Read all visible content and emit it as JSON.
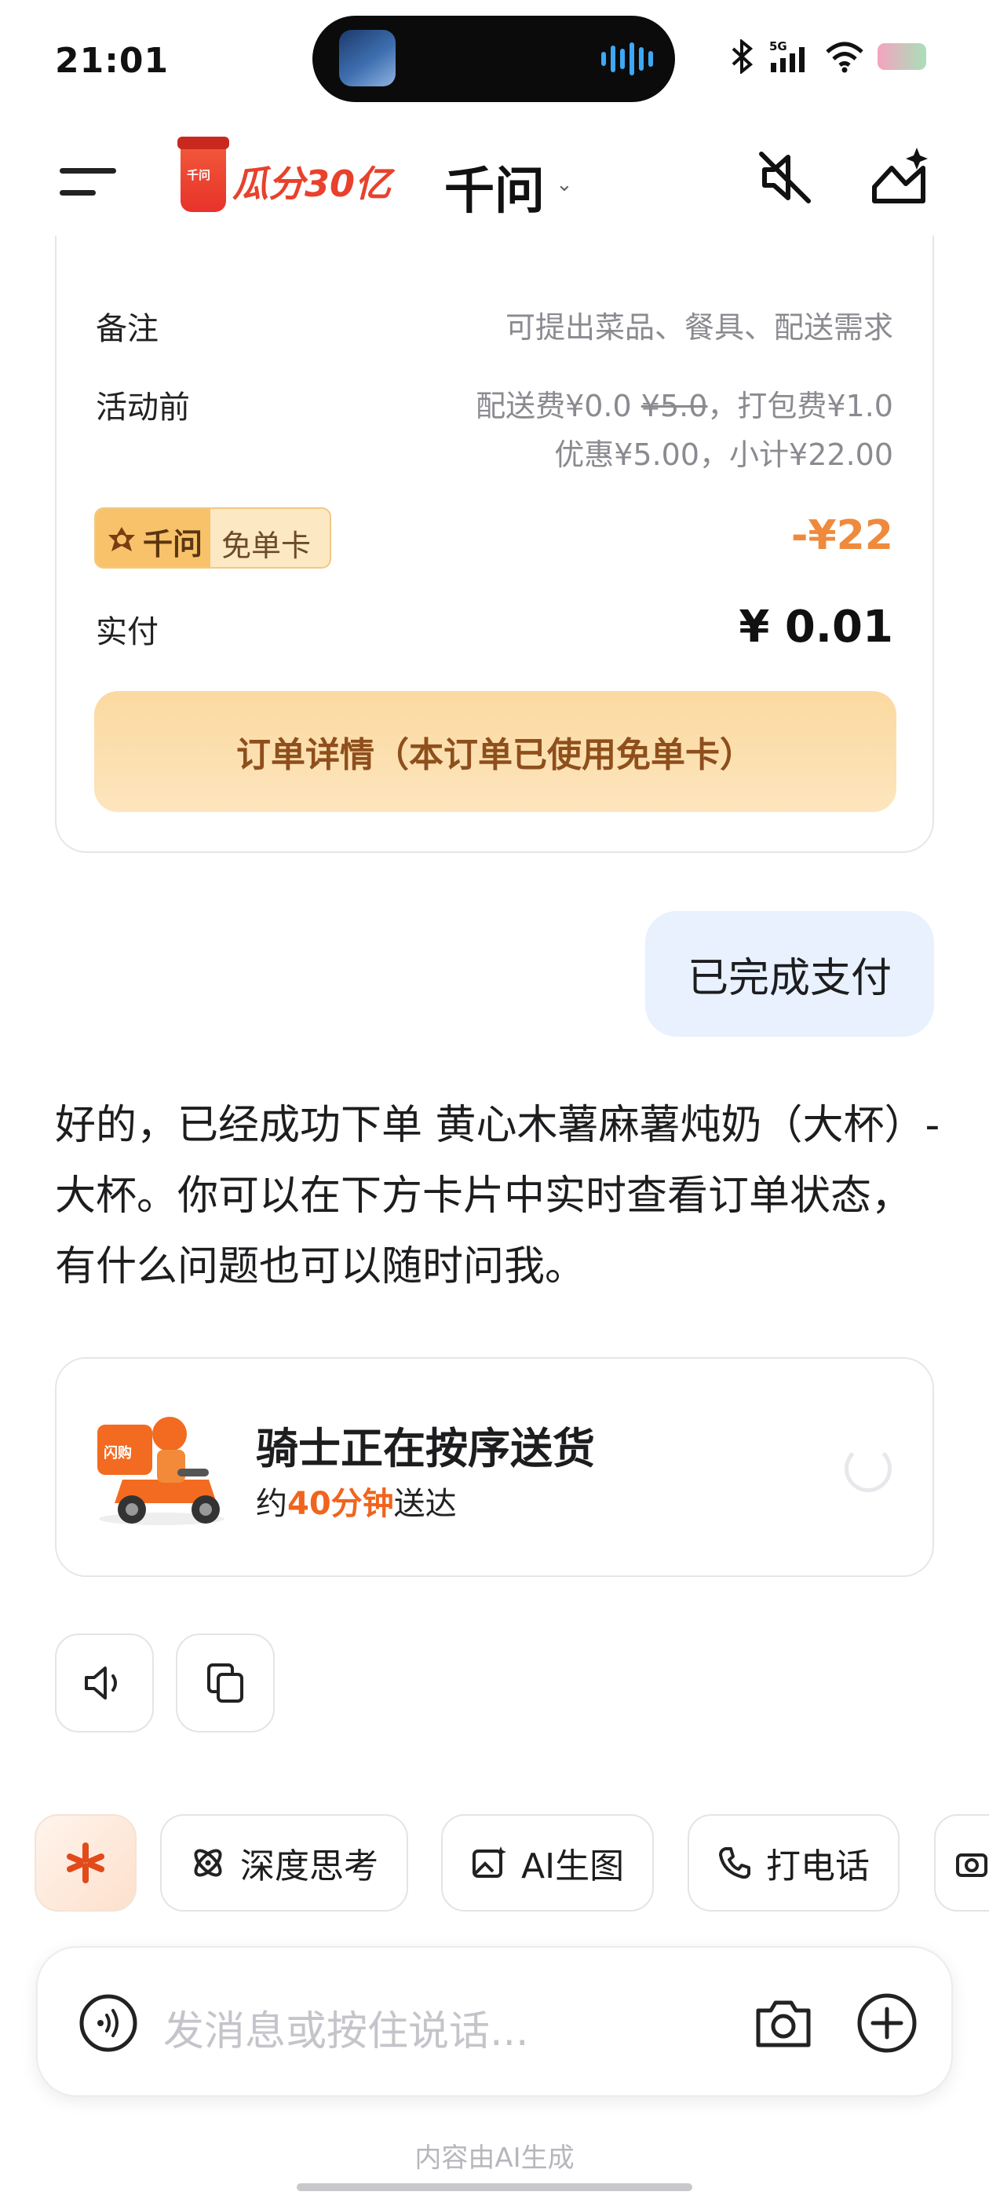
{
  "status_bar": {
    "time": "21:01"
  },
  "header": {
    "logo_text": "瓜分30亿",
    "cup_label": "千问",
    "title": "千问"
  },
  "order": {
    "note_label": "备注",
    "note_value": "可提出菜品、餐具、配送需求",
    "before_label": "活动前",
    "before_line1_prefix": "配送费¥0.0 ",
    "before_line1_strike": "¥5.0",
    "before_line1_suffix": "，打包费¥1.0",
    "before_line2": "优惠¥5.00，小计¥22.00",
    "coupon_brand": "千问",
    "coupon_name": "免单卡",
    "discount": "-¥22",
    "paid_label": "实付",
    "paid_value": "¥ 0.01",
    "detail_button": "订单详情（本订单已使用免单卡）"
  },
  "user_message": "已完成支付",
  "reply": "好的，已经成功下单 黄心木薯麻薯炖奶（大杯）-大杯。你可以在下方卡片中实时查看订单状态，有什么问题也可以随时问我。",
  "delivery": {
    "title": "骑士正在按序送货",
    "eta_prefix": "约",
    "eta_highlight": "40分钟",
    "eta_suffix": "送达"
  },
  "chips": {
    "deep_think": "深度思考",
    "ai_image": "AI生图",
    "phone_call": "打电话"
  },
  "input": {
    "placeholder": "发消息或按住说话..."
  },
  "footer_note": "内容由AI生成",
  "icons": [
    "menu-icon",
    "mute-icon",
    "new-chat-icon",
    "speaker-icon",
    "copy-icon",
    "sparkle-icon",
    "deep-think-icon",
    "image-icon",
    "phone-icon",
    "camera-icon",
    "voice-icon",
    "plus-icon",
    "refresh-icon"
  ],
  "colors": {
    "accent_orange": "#f0641e",
    "discount": "#ef8a3d",
    "user_bubble": "#e8f1fd",
    "detail_button": "#fbd9a0"
  }
}
